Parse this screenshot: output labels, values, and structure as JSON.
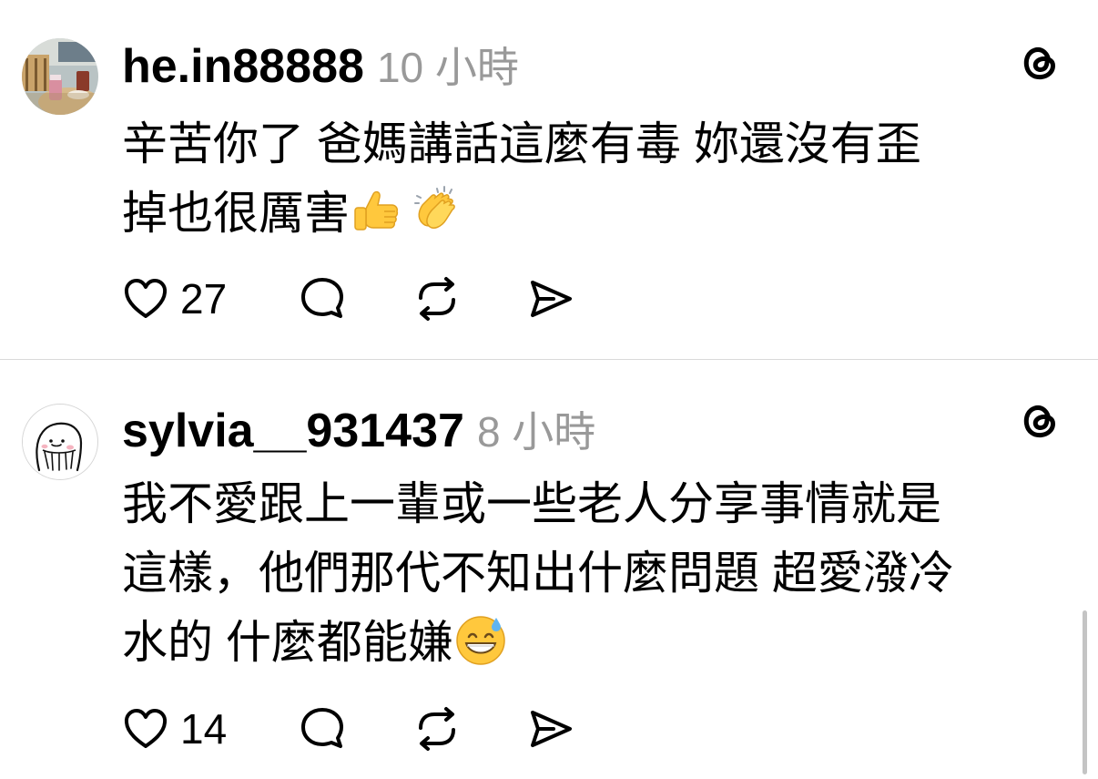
{
  "posts": [
    {
      "username": "he.in88888",
      "time": "10 小時",
      "content_lines": [
        "辛苦你了 爸媽講話這麼有毒 妳還沒有歪",
        "掉也很厲害"
      ],
      "emojis": [
        "thumbs-up",
        "clapping-hands"
      ],
      "likes": "27"
    },
    {
      "username": "sylvia__931437",
      "time": "8 小時",
      "content_lines": [
        "我不愛跟上一輩或一些老人分享事情就是",
        "這樣，他們那代不知出什麼問題 超愛潑冷",
        "水的 什麼都能嫌"
      ],
      "emojis": [
        "grinning-sweat"
      ],
      "likes": "14"
    }
  ],
  "colors": {
    "text": "#000000",
    "muted": "#999999",
    "divider": "#d9d9d9"
  },
  "icons": [
    "threads-logo-icon",
    "heart-icon",
    "comment-icon",
    "repost-icon",
    "share-icon"
  ]
}
